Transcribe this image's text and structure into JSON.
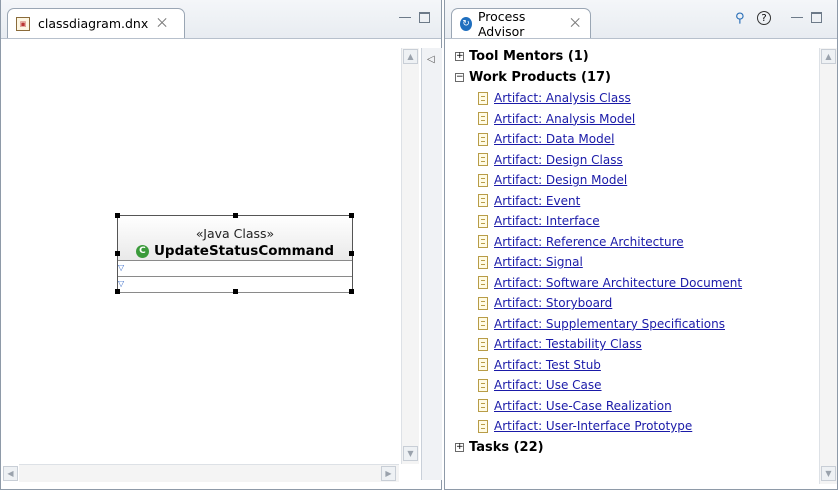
{
  "editor": {
    "tab_title": "classdiagram.dnx",
    "tab_close_glyph": "⨉",
    "file_icon": "diagram-file-icon",
    "class_box": {
      "stereotype": "«Java Class»",
      "class_name": "UpdateStatusCommand",
      "class_icon_glyph": "C"
    }
  },
  "advisor": {
    "tab_title": "Process Advisor",
    "tab_close_glyph": "⨉",
    "groups": [
      {
        "label": "Tool Mentors (1)",
        "expanded": false,
        "expander_glyph": "+",
        "items": []
      },
      {
        "label": "Work Products (17)",
        "expanded": true,
        "expander_glyph": "−",
        "items": [
          "Artifact: Analysis Class",
          "Artifact: Analysis Model",
          "Artifact: Data Model",
          "Artifact: Design Class",
          "Artifact: Design Model",
          "Artifact: Event",
          "Artifact: Interface",
          "Artifact: Reference Architecture",
          "Artifact: Signal",
          "Artifact: Software Architecture Document",
          "Artifact: Storyboard",
          "Artifact: Supplementary Specifications",
          "Artifact: Testability Class",
          "Artifact: Test Stub",
          "Artifact: Use Case",
          "Artifact: Use-Case Realization",
          "Artifact: User-Interface Prototype"
        ]
      },
      {
        "label": "Tasks (22)",
        "expanded": false,
        "expander_glyph": "+",
        "items": []
      }
    ]
  },
  "colors": {
    "link": "#1a1aa8",
    "class_icon": "#3a9a3a",
    "advisor_icon": "#1f6fbf"
  }
}
